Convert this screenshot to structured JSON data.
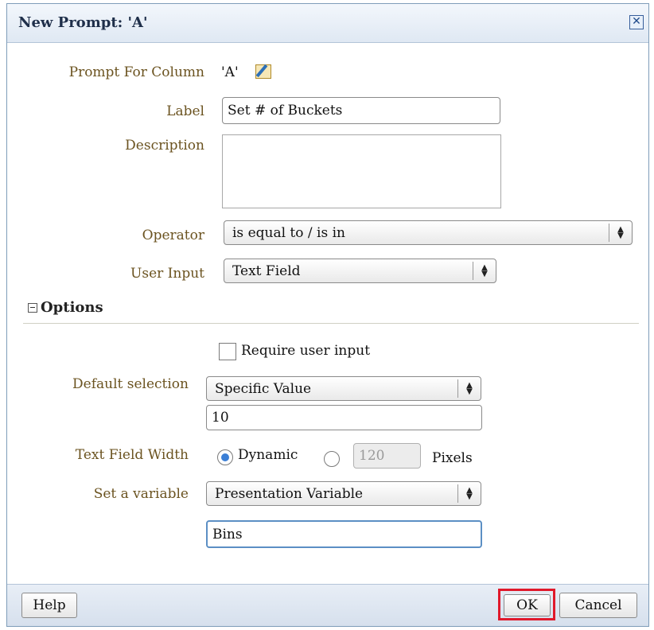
{
  "dialog": {
    "title": "New Prompt: 'A'",
    "close_symbol": "✕"
  },
  "form": {
    "prompt_for_column_label": "Prompt For Column",
    "prompt_for_column_value": "'A'",
    "edit_icon": "edit-formula-icon",
    "label_label": "Label",
    "label_value": "Set # of Buckets",
    "description_label": "Description",
    "description_value": "",
    "operator_label": "Operator",
    "operator_value": "is equal to / is in",
    "user_input_label": "User Input",
    "user_input_value": "Text Field"
  },
  "options": {
    "header": "Options",
    "require_user_input_label": "Require user input",
    "require_user_input_checked": false,
    "default_selection_label": "Default selection",
    "default_selection_value": "Specific Value",
    "default_value": "10",
    "text_field_width_label": "Text Field Width",
    "width_dynamic_label": "Dynamic",
    "width_dynamic_selected": true,
    "width_pixels_value": "120",
    "width_pixels_label": "Pixels",
    "set_variable_label": "Set a variable",
    "set_variable_value": "Presentation Variable",
    "variable_name": "Bins"
  },
  "footer": {
    "help_label": "Help",
    "ok_label": "OK",
    "cancel_label": "Cancel"
  },
  "colors": {
    "label_text": "#6b5320",
    "highlight": "#e0192b",
    "radio_selected": "#3b7fd6"
  }
}
